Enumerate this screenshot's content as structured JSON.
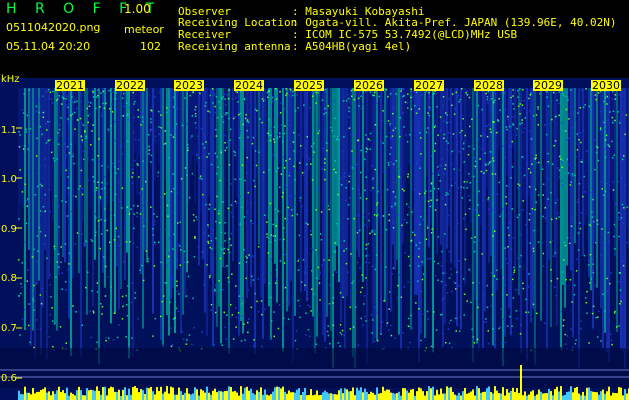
{
  "header": {
    "app_title": "H R O F F T",
    "version": "1.00",
    "file_name": "0511042020.png",
    "datetime": "05.11.04 20:20",
    "meteor_label": "meteor",
    "meteor_count": "102"
  },
  "info": [
    {
      "key": "Observer",
      "value": ": Masayuki Kobayashi"
    },
    {
      "key": "Receiving Location",
      "value": ": Ogata-vill. Akita-Pref. JAPAN (139.96E, 40.02N)"
    },
    {
      "key": "Receiver",
      "value": ": ICOM IC-575 53.7492(@LCD)MHz USB"
    },
    {
      "key": "Receiving antenna",
      "value": ": A504HB(yagi 4el)"
    }
  ],
  "spectrogram": {
    "y_unit": "kHz",
    "y_ticks": [
      "1.1",
      "1.0",
      "0.9",
      "0.8",
      "0.7",
      "0.6"
    ],
    "x_ticks": [
      "2021",
      "2022",
      "2023",
      "2024",
      "2025",
      "2026",
      "2027",
      "2028",
      "2029",
      "2030"
    ],
    "colors": {
      "background": "#00105a",
      "low": "#1e3cd2",
      "mid": "#00c8aa",
      "high": "#64ff32",
      "label": "#ffff00"
    }
  }
}
